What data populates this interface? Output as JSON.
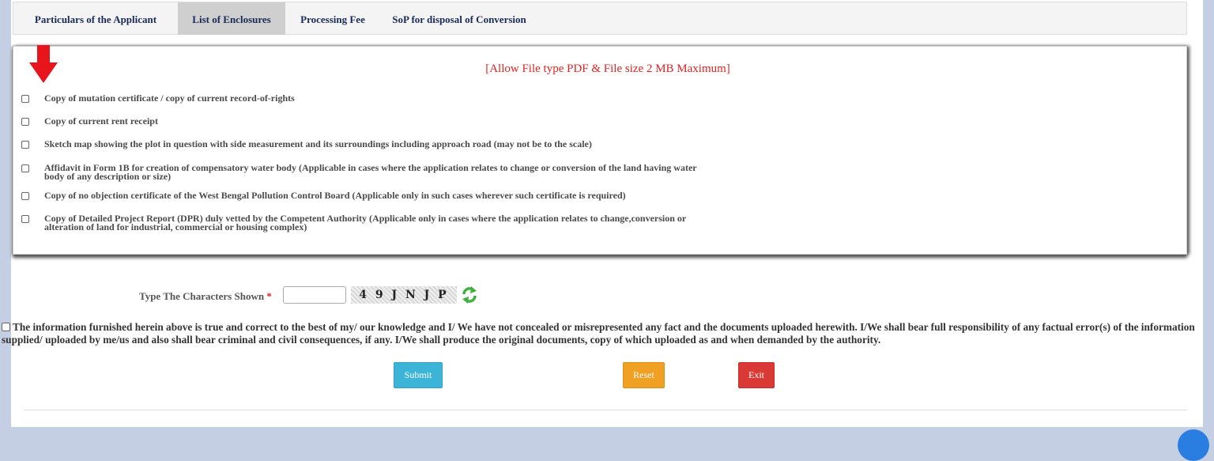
{
  "tabs": [
    {
      "label": "Particulars of the Applicant"
    },
    {
      "label": "List of Enclosures"
    },
    {
      "label": "Processing Fee"
    },
    {
      "label": "SoP for disposal of Conversion"
    }
  ],
  "enclosures": {
    "notice": "[Allow File type PDF & File size 2 MB Maximum]",
    "items": [
      {
        "label": "Copy of mutation certificate / copy of current record-of-rights"
      },
      {
        "label": "Copy of current rent receipt"
      },
      {
        "label": "Sketch map showing the plot in question with side measurement and its surroundings including approach road (may not be to the scale)"
      },
      {
        "label_line1": "Affidavit in Form 1B for creation of compensatory water body (Applicable in cases where the application relates to change or conversion of the land having water",
        "label_line2": "body of any description or size)"
      },
      {
        "label": "Copy of no objection certificate of the West Bengal Pollution Control Board (Applicable only in such cases wherever such certificate is required)"
      },
      {
        "label_line1": "Copy of Detailed Project Report (DPR) duly vetted by the Competent Authority (Applicable only in cases where the application relates to change,conversion or",
        "label_line2": "alteration of land for industrial, commercial or housing complex)"
      }
    ]
  },
  "captcha": {
    "label": "Type The Characters Shown",
    "required_mark": "*",
    "code": "49JNJP",
    "input_value": ""
  },
  "declaration": {
    "text": "The information furnished herein above is true and correct to the best of my/ our knowledge and I/ We have not concealed or misrepresented any fact and the documents uploaded herewith. I/We shall bear full responsibility of any factual error(s) of the information supplied/ uploaded by me/us and also shall bear criminal and civil consequences, if any. I/We shall produce the original documents, copy of which uploaded as and when demanded by the authority."
  },
  "buttons": {
    "submit": "Submit",
    "reset": "Reset",
    "exit": "Exit"
  },
  "colors": {
    "notice": "#e32222",
    "submit": "#3bb4d8",
    "reset": "#f0a022",
    "exit": "#d93a35",
    "arrow": "#e8141b"
  },
  "icons": {
    "pointer": "red-down-arrow-icon",
    "refresh": "refresh-icon"
  }
}
